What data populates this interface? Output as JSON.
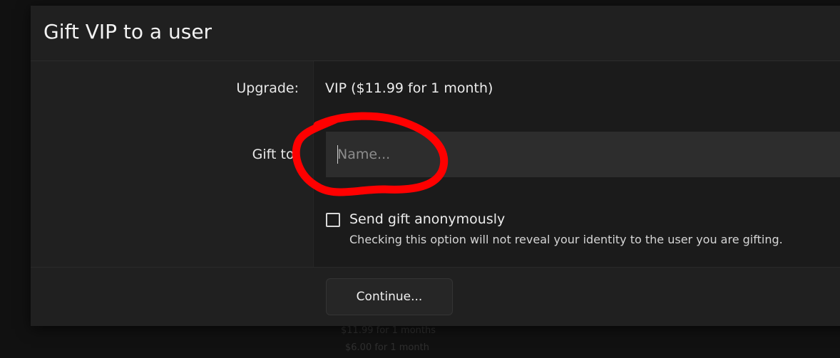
{
  "dialog": {
    "title": "Gift VIP to a user",
    "upgrade": {
      "label": "Upgrade:",
      "value": "VIP ($11.99 for 1 month)"
    },
    "gift_to": {
      "label": "Gift to:",
      "placeholder": "Name...",
      "value": ""
    },
    "anonymous": {
      "label": "Send gift anonymously",
      "hint": "Checking this option will not reveal your identity to the user you are gifting.",
      "checked": false
    },
    "continue_label": "Continue..."
  },
  "background": {
    "line1": "$11.99 for 1 months",
    "line2": "$6.00 for 1 month"
  },
  "annotation": {
    "color": "#ff0000"
  }
}
